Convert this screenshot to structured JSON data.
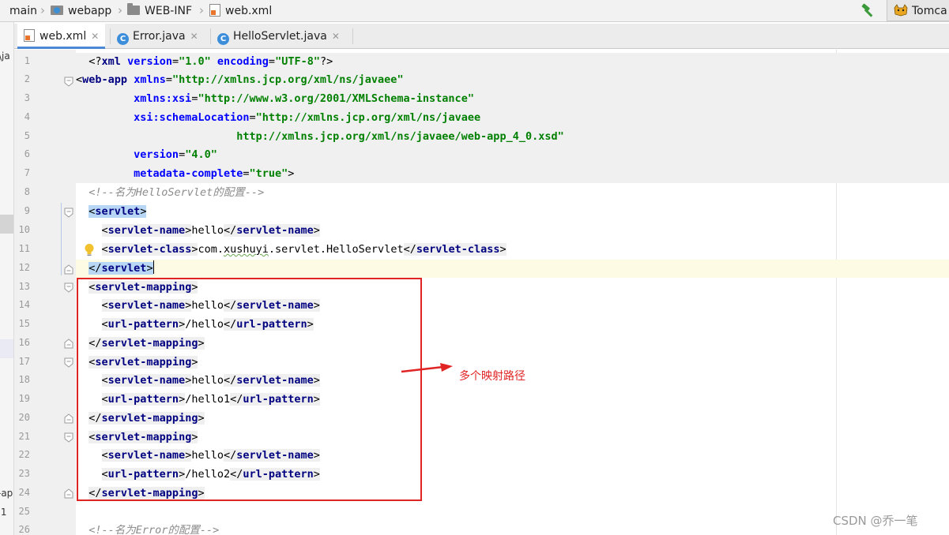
{
  "breadcrumb": [
    {
      "label": "main",
      "icon": "none"
    },
    {
      "label": "webapp",
      "icon": "web-module-folder-icon"
    },
    {
      "label": "WEB-INF",
      "icon": "folder-icon"
    },
    {
      "label": "web.xml",
      "icon": "xml-file-icon"
    }
  ],
  "toolbar": {
    "build_icon": "hammer-icon",
    "run_config_label": "Tomca"
  },
  "tabs": [
    {
      "label": "web.xml",
      "active": true,
      "icon": "xml-file-icon"
    },
    {
      "label": "Error.java",
      "active": false,
      "icon": "java-class-icon"
    },
    {
      "label": "HelloServlet.java",
      "active": false,
      "icon": "java-class-icon"
    }
  ],
  "left_panel": {
    "fragments": [
      "\\ja",
      "-ap",
      ".1"
    ]
  },
  "line_numbers": [
    "1",
    "2",
    "3",
    "4",
    "5",
    "6",
    "7",
    "8",
    "9",
    "10",
    "11",
    "12",
    "13",
    "14",
    "15",
    "16",
    "17",
    "18",
    "19",
    "20",
    "21",
    "22",
    "23",
    "24",
    "25",
    "26"
  ],
  "code": {
    "l1": {
      "pi_open": "<?",
      "pi_name": "xml",
      "a1": "version",
      "v1": "\"1.0\"",
      "a2": "encoding",
      "v2": "\"UTF-8\"",
      "pi_close": "?>"
    },
    "l2": {
      "open": "<",
      "tag": "web-app",
      "attr": "xmlns",
      "val": "\"http://xmlns.jcp.org/xml/ns/javaee\""
    },
    "l3": {
      "attr": "xmlns:xsi",
      "val": "\"http://www.w3.org/2001/XMLSchema-instance\""
    },
    "l4": {
      "attr": "xsi:schemaLocation",
      "val": "\"http://xmlns.jcp.org/xml/ns/javaee"
    },
    "l5": {
      "val": "http://xmlns.jcp.org/xml/ns/javaee/web-app_4_0.xsd\""
    },
    "l6": {
      "attr": "version",
      "val": "\"4.0\""
    },
    "l7": {
      "attr": "metadata-complete",
      "val": "\"true\"",
      "close": ">"
    },
    "l8": {
      "comment": "<!--名为HelloServlet的配置-->"
    },
    "l9": {
      "lt": "<",
      "tag": "servlet",
      "gt": ">"
    },
    "l10": {
      "lt": "<",
      "tag": "servlet-name",
      "gt": ">",
      "text": "hello",
      "clt": "</",
      "ctag": "servlet-name",
      "cgt": ">"
    },
    "l11": {
      "lt": "<",
      "tag": "servlet-class",
      "gt": ">",
      "text_a": "com.",
      "text_b": "xushuyi",
      "text_c": ".servlet.HelloServlet",
      "clt": "</",
      "ctag": "servlet-class",
      "cgt": ">"
    },
    "l12": {
      "lt": "</",
      "tag": "servlet",
      "gt": ">"
    },
    "l13": {
      "lt": "<",
      "tag": "servlet-mapping",
      "gt": ">"
    },
    "l14": {
      "lt": "<",
      "tag": "servlet-name",
      "gt": ">",
      "text": "hello",
      "clt": "</",
      "ctag": "servlet-name",
      "cgt": ">"
    },
    "l15": {
      "lt": "<",
      "tag": "url-pattern",
      "gt": ">",
      "text": "/hello",
      "clt": "</",
      "ctag": "url-pattern",
      "cgt": ">"
    },
    "l16": {
      "lt": "</",
      "tag": "servlet-mapping",
      "gt": ">"
    },
    "l17": {
      "lt": "<",
      "tag": "servlet-mapping",
      "gt": ">"
    },
    "l18": {
      "lt": "<",
      "tag": "servlet-name",
      "gt": ">",
      "text": "hello",
      "clt": "</",
      "ctag": "servlet-name",
      "cgt": ">"
    },
    "l19": {
      "lt": "<",
      "tag": "url-pattern",
      "gt": ">",
      "text": "/hello1",
      "clt": "</",
      "ctag": "url-pattern",
      "cgt": ">"
    },
    "l20": {
      "lt": "</",
      "tag": "servlet-mapping",
      "gt": ">"
    },
    "l21": {
      "lt": "<",
      "tag": "servlet-mapping",
      "gt": ">"
    },
    "l22": {
      "lt": "<",
      "tag": "servlet-name",
      "gt": ">",
      "text": "hello",
      "clt": "</",
      "ctag": "servlet-name",
      "cgt": ">"
    },
    "l23": {
      "lt": "<",
      "tag": "url-pattern",
      "gt": ">",
      "text": "/hello2",
      "clt": "</",
      "ctag": "url-pattern",
      "cgt": ">"
    },
    "l24": {
      "lt": "</",
      "tag": "servlet-mapping",
      "gt": ">"
    },
    "l26": {
      "comment": "<!--名为Error的配置-->"
    }
  },
  "annotation": {
    "text": "多个映射路径",
    "color": "#e02424"
  },
  "watermark": "CSDN @乔一笔",
  "colors": {
    "tag": "#000080",
    "attribute": "#0000ff",
    "value": "#008000",
    "comment": "#8c8c8c",
    "selection": "#b8d7f5",
    "active_tab_underline": "#4b88d6"
  }
}
